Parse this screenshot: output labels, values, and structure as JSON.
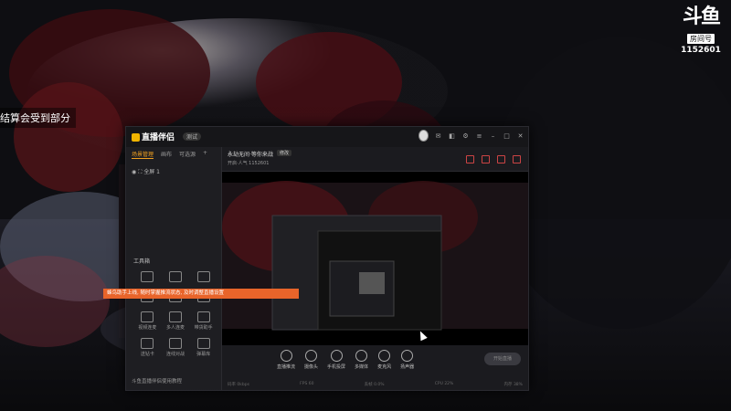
{
  "watermark": {
    "logo": "斗鱼",
    "room_label": "房间号",
    "room_number": "1152601"
  },
  "overlay_text": "结算会受到部分",
  "app": {
    "name": "直播伴侣",
    "version": "测试",
    "left_tabs": [
      "场景管理",
      "画布",
      "可选源"
    ],
    "scene_name": "全屏 1",
    "tools_header": "工具箱",
    "tools": [
      "",
      "",
      "",
      "",
      "",
      "",
      "视频连麦",
      "多人连麦",
      "带货助手",
      "送钻卡",
      "连线对战",
      "弹幕库"
    ],
    "toast": "蜂鸟助手上线, 随时掌握推流状态, 及时调整直播设置",
    "footer_link": "斗鱼直播伴侣使用教程",
    "stream_title": "永劫无间·等你来战",
    "stream_badge": "修改",
    "stream_sub": "开启·人气 1152601",
    "controls": [
      "直播推流",
      "摄像头",
      "手机投屏",
      "多媒体",
      "麦克风",
      "扬声器"
    ],
    "go_button": "开始直播",
    "status": [
      "码率 0kbps",
      "FPS 60",
      "丢帧 0.0%",
      "CPU 22%",
      "内存 38%"
    ]
  }
}
